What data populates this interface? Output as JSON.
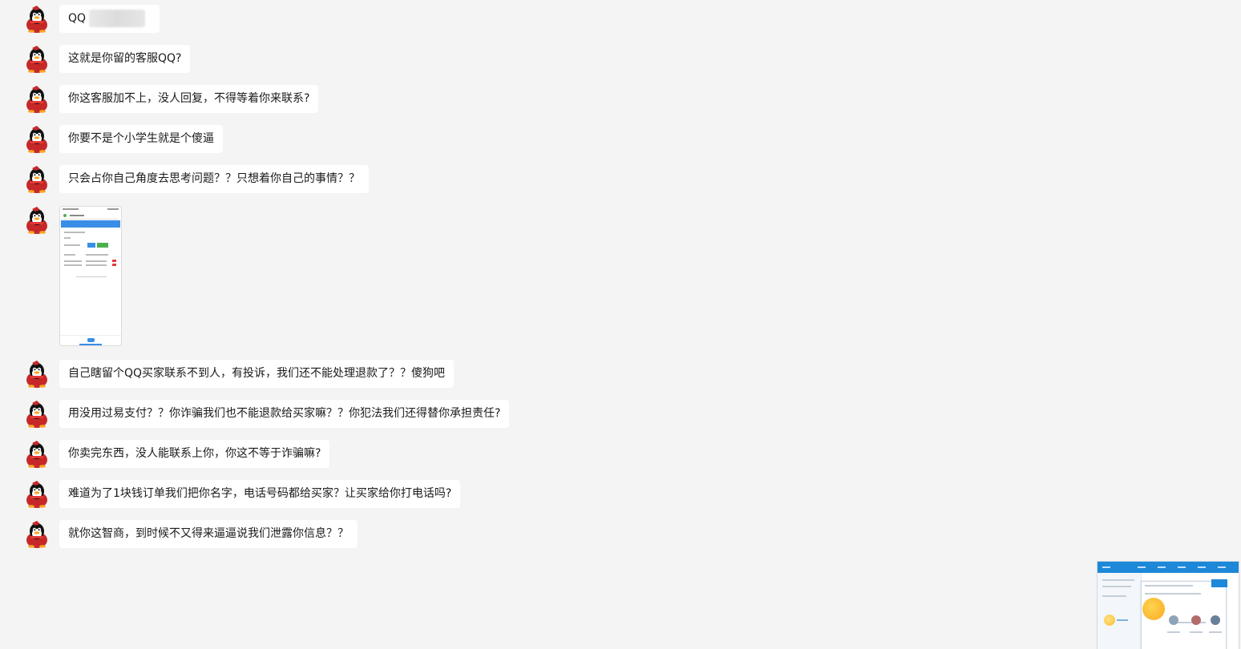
{
  "messages": [
    {
      "type": "text",
      "text": "QQ"
    },
    {
      "type": "text",
      "text": "这就是你留的客服QQ?"
    },
    {
      "type": "text",
      "text": "你这客服加不上，没人回复，不得等着你来联系?"
    },
    {
      "type": "text",
      "text": "你要不是个小学生就是个傻逼"
    },
    {
      "type": "text",
      "text": "只会占你自己角度去思考问题？？只想着你自己的事情？？"
    },
    {
      "type": "image"
    },
    {
      "type": "text",
      "text": "自己瞎留个QQ买家联系不到人，有投诉，我们还不能处理退款了？？傻狗吧"
    },
    {
      "type": "text",
      "text": "用没用过易支付？？你诈骗我们也不能退款给买家嘛？？你犯法我们还得替你承担责任?"
    },
    {
      "type": "text",
      "text": "你卖完东西，没人能联系上你，你这不等于诈骗嘛?"
    },
    {
      "type": "text",
      "text": "难道为了1块钱订单我们把你名字，电话号码都给买家？让买家给你打电话吗?"
    },
    {
      "type": "text",
      "text": "就你这智商，到时候不又得来逼逼说我们泄露你信息？？"
    }
  ],
  "avatar_icon": "qq-penguin-icon",
  "colors": {
    "background": "#f4f4f4",
    "bubble": "#ffffff",
    "text": "#1a1a1a",
    "penguin_red": "#d32f2f",
    "accent_blue": "#1e88d8"
  }
}
